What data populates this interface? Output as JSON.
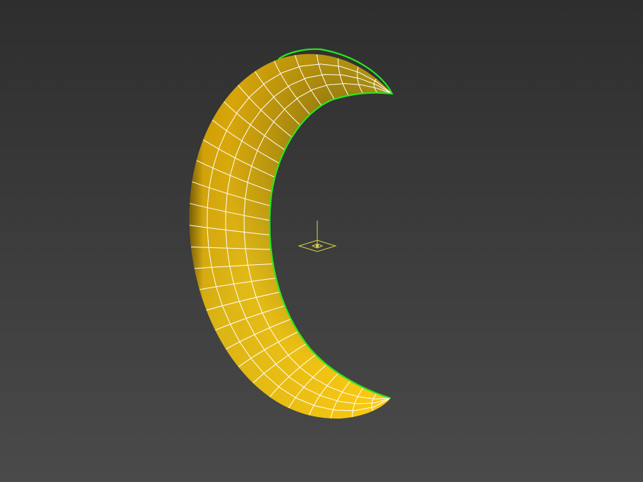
{
  "viewport": {
    "background_top": "#2e2e2e",
    "background_bottom": "#4a4a4a",
    "shading_mode": "shaded-with-wireframe"
  },
  "object": {
    "shape": "crescent",
    "color_light": "#ffd21a",
    "color_mid": "#f0b000",
    "color_dark": "#7a4d00",
    "wireframe_color": "#ffffff",
    "selection_edge_color": "#27e81c"
  },
  "pivot": {
    "icon": "pivot-gizmo-icon",
    "color": "#d9d44a"
  }
}
